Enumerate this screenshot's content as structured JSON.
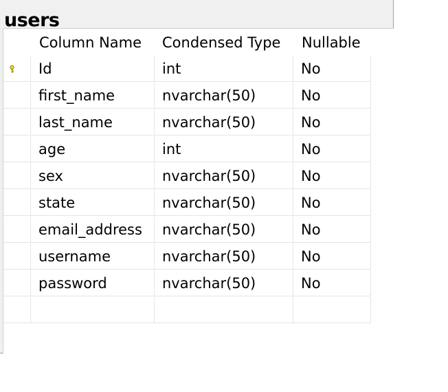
{
  "table": {
    "title": "users",
    "columns_header": {
      "name": "Column Name",
      "type": "Condensed Type",
      "nullable": "Nullable"
    },
    "rows": [
      {
        "name": "Id",
        "type": "int",
        "nullable": "No",
        "primary_key": true
      },
      {
        "name": "first_name",
        "type": "nvarchar(50)",
        "nullable": "No"
      },
      {
        "name": "last_name",
        "type": "nvarchar(50)",
        "nullable": "No"
      },
      {
        "name": "age",
        "type": "int",
        "nullable": "No"
      },
      {
        "name": "sex",
        "type": "nvarchar(50)",
        "nullable": "No"
      },
      {
        "name": "state",
        "type": "nvarchar(50)",
        "nullable": "No"
      },
      {
        "name": "email_address",
        "type": "nvarchar(50)",
        "nullable": "No"
      },
      {
        "name": "username",
        "type": "nvarchar(50)",
        "nullable": "No"
      },
      {
        "name": "password",
        "type": "nvarchar(50)",
        "nullable": "No"
      },
      {
        "name": "",
        "type": "",
        "nullable": ""
      }
    ]
  },
  "icons": {
    "primary_key": "key-icon"
  },
  "colors": {
    "key_icon": "#e8c800",
    "grid_line": "#e4e4e4",
    "frame_background": "#f0f0f0"
  }
}
